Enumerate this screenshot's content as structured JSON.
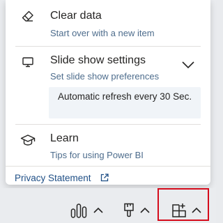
{
  "menu": {
    "clear_data": {
      "icon": "eraser-icon",
      "title": "Clear data",
      "subtitle": "Start over with a new item"
    },
    "slideshow": {
      "icon": "monitor-icon",
      "title": "Slide show settings",
      "subtitle": "Set slide show preferences",
      "expanded": true,
      "option": "Automatic refresh every 30 Sec."
    },
    "learn": {
      "icon": "graduation-cap-icon",
      "title": "Learn",
      "subtitle": "Tips for using Power BI"
    },
    "privacy_link": "Privacy Statement"
  },
  "footer": {
    "buttons": [
      {
        "icon": "bar-chart-icon",
        "chevron": "chevron-up-icon"
      },
      {
        "icon": "paint-brush-icon",
        "chevron": "chevron-up-icon"
      },
      {
        "icon": "add-visual-icon",
        "chevron": "chevron-up-icon",
        "highlighted": true
      }
    ]
  },
  "colors": {
    "accent_text": "#4d6c8c",
    "link": "#1f4f86",
    "highlight_border": "#d50b1b",
    "option_bg": "#f0f4f8"
  }
}
